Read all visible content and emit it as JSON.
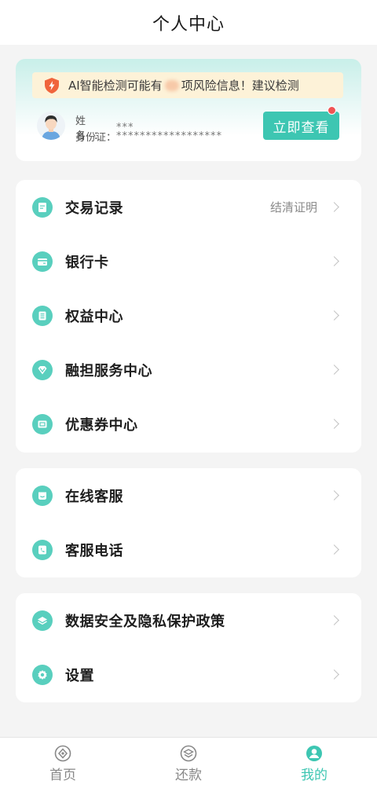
{
  "header": {
    "title": "个人中心"
  },
  "user_card": {
    "alert_prefix": "AI智能检测可能有",
    "alert_suffix": "项风险信息！建议检测",
    "name_label": "姓名：",
    "name_value": "***",
    "id_label": "身份证：",
    "id_value": "******************",
    "check_button": "立即查看"
  },
  "menu_group_1": [
    {
      "label": "交易记录",
      "extra": "结清证明",
      "icon": "document-icon"
    },
    {
      "label": "银行卡",
      "extra": "",
      "icon": "bank-card-icon"
    },
    {
      "label": "权益中心",
      "extra": "",
      "icon": "benefits-icon"
    },
    {
      "label": "融担服务中心",
      "extra": "",
      "icon": "diamond-icon"
    },
    {
      "label": "优惠券中心",
      "extra": "",
      "icon": "coupon-icon"
    }
  ],
  "menu_group_2": [
    {
      "label": "在线客服",
      "icon": "chat-icon"
    },
    {
      "label": "客服电话",
      "icon": "phone-icon"
    }
  ],
  "menu_group_3": [
    {
      "label": "数据安全及隐私保护政策",
      "icon": "layers-icon"
    },
    {
      "label": "设置",
      "icon": "gear-icon"
    }
  ],
  "tabbar": [
    {
      "label": "首页",
      "icon": "home-icon"
    },
    {
      "label": "还款",
      "icon": "repay-icon"
    },
    {
      "label": "我的",
      "icon": "profile-icon"
    }
  ],
  "colors": {
    "accent": "#3dc6b2",
    "alert_bg": "#fdf2d8",
    "badge": "#f05454"
  }
}
